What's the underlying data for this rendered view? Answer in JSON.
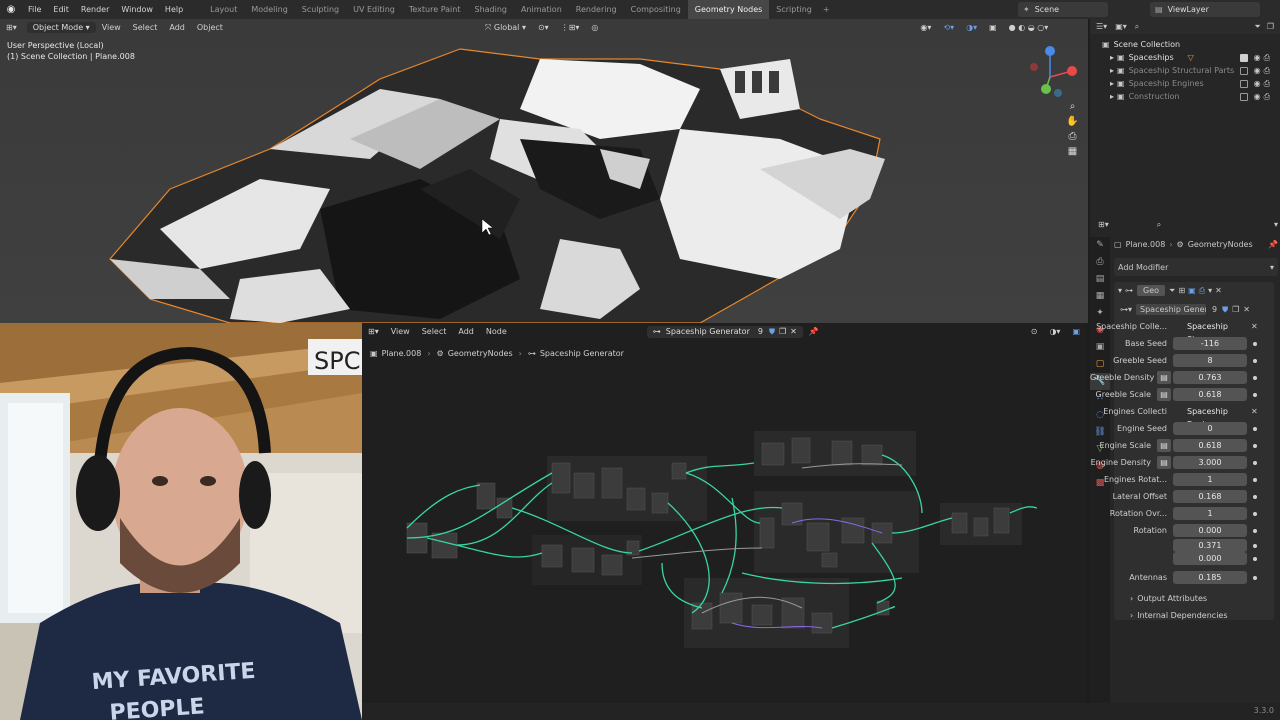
{
  "menubar": {
    "logo": "blender-icon",
    "menus": [
      "File",
      "Edit",
      "Render",
      "Window",
      "Help"
    ],
    "workspaces": [
      "Layout",
      "Modeling",
      "Sculpting",
      "UV Editing",
      "Texture Paint",
      "Shading",
      "Animation",
      "Rendering",
      "Compositing",
      "Geometry Nodes",
      "Scripting"
    ],
    "active_workspace": "Geometry Nodes",
    "scene": "Scene",
    "view_layer": "ViewLayer"
  },
  "viewport": {
    "mode": "Object Mode",
    "menus": [
      "View",
      "Select",
      "Add",
      "Object"
    ],
    "transform_orientation": "Global",
    "info_line1": "User Perspective (Local)",
    "info_line2": "(1) Scene Collection | Plane.008"
  },
  "outliner": {
    "root": "Scene Collection",
    "items": [
      {
        "label": "Spaceships",
        "active": true
      },
      {
        "label": "Spaceship Structural Parts",
        "active": false
      },
      {
        "label": "Spaceship Engines",
        "active": false
      },
      {
        "label": "Construction",
        "active": false
      }
    ]
  },
  "properties": {
    "object": "Plane.008",
    "modifier_name": "GeometryNodes",
    "add_modifier": "Add Modifier",
    "mod_short": "Geo",
    "node_group": "Spaceship Genera...",
    "node_group_users": "9",
    "rows": [
      {
        "label": "Spaceship Colle...",
        "value": "Spaceship Stru...",
        "kind": "coll"
      },
      {
        "label": "Base Seed",
        "value": "-116",
        "kind": "num"
      },
      {
        "label": "Greeble Seed",
        "value": "8",
        "kind": "num"
      },
      {
        "label": "Greeble Density",
        "value": "0.763",
        "kind": "attr"
      },
      {
        "label": "Greeble Scale",
        "value": "0.618",
        "kind": "attr"
      },
      {
        "label": "Engines Collecti",
        "value": "Spaceship Engi...",
        "kind": "coll"
      },
      {
        "label": "Engine Seed",
        "value": "0",
        "kind": "num"
      },
      {
        "label": "Engine Scale",
        "value": "0.618",
        "kind": "attr"
      },
      {
        "label": "Engine Density",
        "value": "3.000",
        "kind": "attr"
      },
      {
        "label": "Engines Rotat...",
        "value": "1",
        "kind": "num"
      },
      {
        "label": "Lateral Offset",
        "value": "0.168",
        "kind": "num"
      },
      {
        "label": "Rotation Ovr...",
        "value": "1",
        "kind": "num"
      },
      {
        "label": "Rotation",
        "value": "0.000",
        "kind": "num"
      },
      {
        "label": "",
        "value": "0.371",
        "kind": "num"
      },
      {
        "label": "",
        "value": "0.000",
        "kind": "num"
      },
      {
        "label": "Antennas",
        "value": "0.185",
        "kind": "num"
      }
    ],
    "subpanels": [
      "Output Attributes",
      "Internal Dependencies"
    ]
  },
  "node_editor": {
    "menus": [
      "View",
      "Select",
      "Add",
      "Node"
    ],
    "node_group": "Spaceship Generator",
    "users": "9",
    "breadcrumb": [
      "Plane.008",
      "GeometryNodes",
      "Spaceship Generator"
    ]
  },
  "webcam": {
    "sign_text": "SPC",
    "shirt_text_1": "MY FAVORITE",
    "shirt_text_2": "PEOPLE"
  },
  "status": {
    "version": "3.3.0"
  },
  "colors": {
    "accent": "#4772b3",
    "active_tab": "#474747",
    "node_link": "#38d6a0",
    "selected_outline": "#e8862a"
  }
}
